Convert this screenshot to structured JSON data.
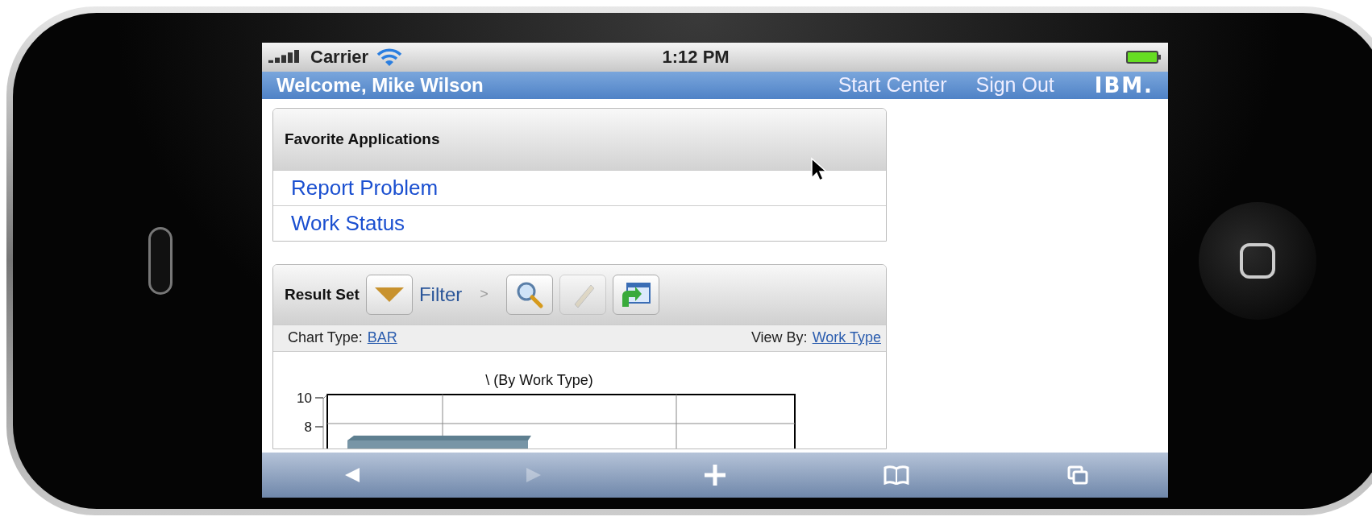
{
  "status_bar": {
    "carrier": "Carrier",
    "time": "1:12 PM"
  },
  "header": {
    "welcome": "Welcome, Mike Wilson",
    "links": [
      "Start Center",
      "Sign Out"
    ],
    "logo": "IBM."
  },
  "favorites": {
    "title": "Favorite Applications",
    "items": [
      "Report Problem",
      "Work Status"
    ]
  },
  "result_set": {
    "title": "Result Set",
    "filter": "Filter",
    "separator": ">",
    "tools": [
      {
        "kind": "search",
        "disabled": false
      },
      {
        "kind": "eraser",
        "disabled": true
      },
      {
        "kind": "window",
        "disabled": false
      }
    ],
    "chart_type_label": "Chart Type:",
    "chart_type": "BAR",
    "view_by_label": "View By:",
    "view_by": "Work Type"
  },
  "chart": {
    "title": "\\ (By Work Type)",
    "y_tick_labels": [
      "10",
      "8"
    ]
  },
  "browser_toolbar": [
    {
      "kind": "back",
      "disabled": false
    },
    {
      "kind": "forward",
      "disabled": true
    },
    {
      "kind": "add",
      "disabled": false
    },
    {
      "kind": "bookmarks",
      "disabled": false
    },
    {
      "kind": "pages",
      "disabled": false
    }
  ]
}
